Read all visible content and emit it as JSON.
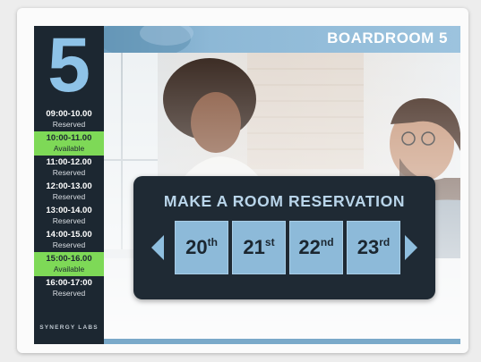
{
  "room": {
    "number": "5",
    "name": "BOARDROOM 5"
  },
  "schedule": [
    {
      "time": "09:00-10.00",
      "status": "Reserved",
      "available": false
    },
    {
      "time": "10:00-11.00",
      "status": "Available",
      "available": true
    },
    {
      "time": "11:00-12.00",
      "status": "Reserved",
      "available": false
    },
    {
      "time": "12:00-13.00",
      "status": "Reserved",
      "available": false
    },
    {
      "time": "13:00-14.00",
      "status": "Reserved",
      "available": false
    },
    {
      "time": "14:00-15.00",
      "status": "Reserved",
      "available": false
    },
    {
      "time": "15:00-16.00",
      "status": "Available",
      "available": true
    },
    {
      "time": "16:00-17:00",
      "status": "Reserved",
      "available": false
    }
  ],
  "company": "SYNERGY LABS",
  "reservation": {
    "title": "MAKE A ROOM RESERVATION",
    "dates": [
      {
        "day": "20",
        "suffix": "th"
      },
      {
        "day": "21",
        "suffix": "st"
      },
      {
        "day": "22",
        "suffix": "nd"
      },
      {
        "day": "23",
        "suffix": "rd"
      }
    ],
    "prev_icon": "triangle-left-icon",
    "next_icon": "triangle-right-icon"
  },
  "colors": {
    "sidebar_bg": "#1c2731",
    "available": "#7ed957",
    "accent": "#8ec3e8",
    "button": "#8dbad9",
    "panel_bg": "#1f2a34"
  }
}
